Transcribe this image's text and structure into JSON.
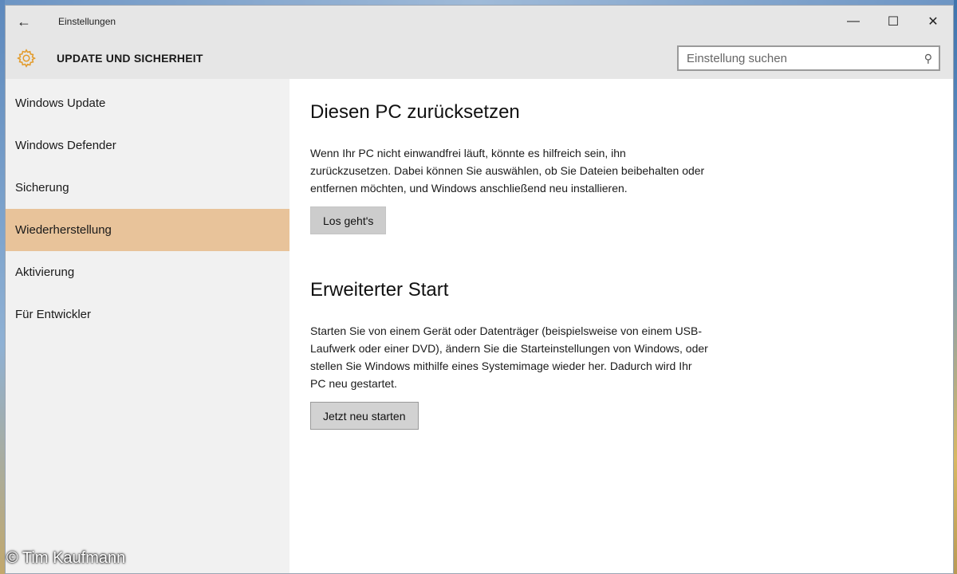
{
  "window": {
    "title": "Einstellungen",
    "back_glyph": "←",
    "controls": {
      "minimize": "—",
      "maximize": "☐",
      "close": "✕"
    }
  },
  "header": {
    "icon": "gear-icon",
    "title": "UPDATE UND SICHERHEIT"
  },
  "search": {
    "placeholder": "Einstellung suchen"
  },
  "sidebar": {
    "items": [
      {
        "label": "Windows Update",
        "active": false
      },
      {
        "label": "Windows Defender",
        "active": false
      },
      {
        "label": "Sicherung",
        "active": false
      },
      {
        "label": "Wiederherstellung",
        "active": true
      },
      {
        "label": "Aktivierung",
        "active": false
      },
      {
        "label": "Für Entwickler",
        "active": false
      }
    ]
  },
  "main": {
    "reset": {
      "heading": "Diesen PC zurücksetzen",
      "text": "Wenn Ihr PC nicht einwandfrei läuft, könnte es hilfreich sein, ihn zurückzusetzen. Dabei können Sie auswählen, ob Sie Dateien beibehalten oder entfernen möchten, und Windows anschließend neu installieren.",
      "button": "Los geht's"
    },
    "advanced": {
      "heading": "Erweiterter Start",
      "text": "Starten Sie von einem Gerät oder Datenträger (beispielsweise von einem USB-Laufwerk oder einer DVD), ändern Sie die Starteinstellungen von Windows, oder stellen Sie Windows mithilfe eines Systemimage wieder her. Dadurch wird Ihr PC neu gestartet.",
      "button": "Jetzt neu starten"
    }
  },
  "watermark": "© Tim Kaufmann",
  "colors": {
    "accent_orange": "#e39b2a",
    "active_item": "#e8c39a",
    "chrome_gray": "#e6e6e6"
  }
}
